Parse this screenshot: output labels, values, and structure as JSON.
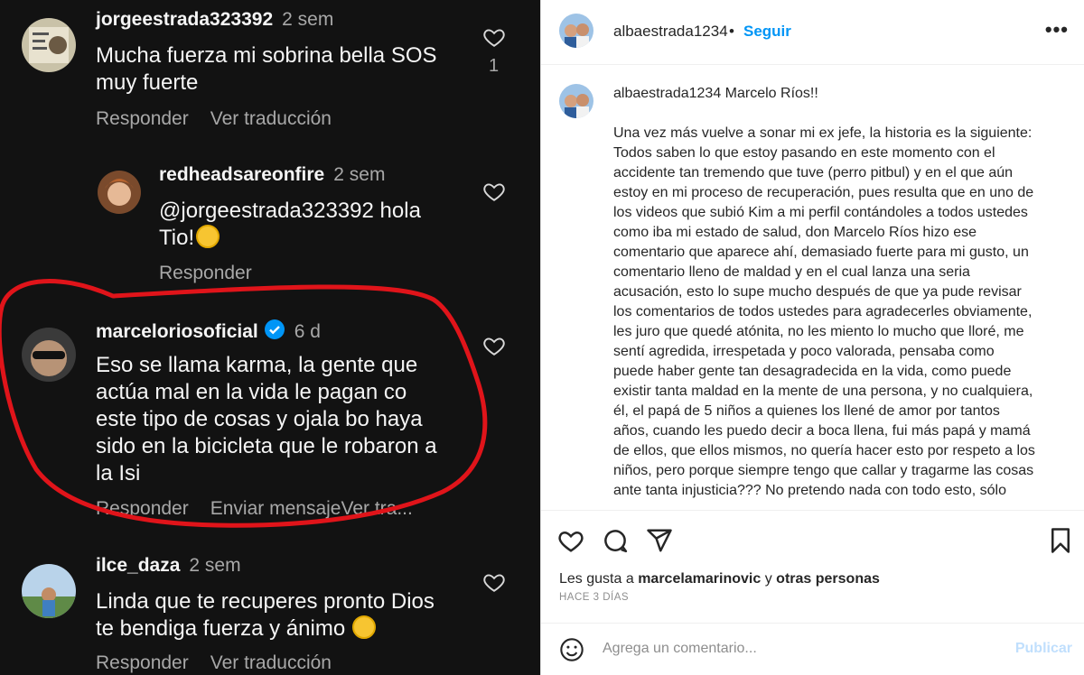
{
  "comments": [
    {
      "user": "jorgeestrada323392",
      "time": "2 sem",
      "text_lines": [
        "Mucha fuerza mi sobrina bella SOS",
        "muy fuerte"
      ],
      "actions": [
        "Responder",
        "Ver traducción"
      ],
      "likes": "1"
    },
    {
      "user": "redheadsareonfire",
      "time": "2 sem",
      "text_lines": [
        "@jorgeestrada323392 hola",
        "Tio!"
      ],
      "actions": [
        "Responder"
      ]
    },
    {
      "user": "marceloriosoficial",
      "time": "6 d",
      "verified": true,
      "text_lines": [
        "Eso se llama karma, la gente que",
        "actúa mal en la vida le pagan co",
        "este tipo de cosas y ojala bo haya",
        "sido en la bicicleta que le robaron a",
        "la Isi"
      ],
      "actions": [
        "Responder",
        "Enviar mensajeVer tra..."
      ]
    },
    {
      "user": "ilce_daza",
      "time": "2 sem",
      "text_lines": [
        "Linda que te recuperes pronto Dios",
        "te bendiga fuerza y ánimo"
      ],
      "actions": [
        "Responder",
        "Ver traducción"
      ]
    }
  ],
  "post": {
    "author": "albaestrada1234",
    "follow_label": "Seguir",
    "dot": "•",
    "more": "•••",
    "caption_first": "Marcelo Ríos!!",
    "caption_lines": [
      "Una vez más vuelve a sonar mi ex jefe, la historia es la siguiente:",
      "Todos saben lo que estoy pasando en este momento con el",
      "accidente tan tremendo que tuve (perro pitbul) y en el que aún",
      "estoy en mi proceso de recuperación, pues resulta que en uno de",
      "los videos que subió Kim a mi perfil contándoles a todos ustedes",
      "como iba mi estado de salud, don Marcelo Ríos hizo ese",
      "comentario que aparece ahí, demasiado fuerte para mi gusto, un",
      "comentario lleno de maldad y en el cual lanza una seria",
      "acusación, esto lo supe mucho después de que ya pude revisar",
      "los comentarios de todos ustedes para agradecerles obviamente,",
      "les juro que quedé atónita, no les miento lo mucho que lloré, me",
      "sentí agredida, irrespetada y poco valorada, pensaba como",
      "puede haber gente tan desagradecida en la vida, como puede",
      "existir tanta maldad en la mente de una persona, y no cualquiera,",
      "él, el papá de 5 niños a quienes los llené de amor por tantos",
      "años, cuando les puedo decir a boca llena, fui más papá y mamá",
      "de ellos, que ellos mismos, no quería hacer esto por respeto a los",
      "niños, pero porque siempre tengo que callar y tragarme las cosas",
      "ante tanta injusticia??? No pretendo nada con todo esto, sólo"
    ],
    "likes_prefix": "Les gusta a",
    "likes_user": "marcelamarinovic",
    "likes_and": "y",
    "likes_others": "otras personas",
    "date": "HACE 3 DÍAS",
    "comment_placeholder": "Agrega un comentario...",
    "publish_label": "Publicar"
  },
  "icons": [
    "heart-icon",
    "comment-icon",
    "share-icon",
    "bookmark-icon",
    "smile-icon",
    "verified-icon",
    "more-icon"
  ],
  "colors": {
    "link_blue": "#0095f6",
    "dark_bg": "#121212",
    "red_annotation": "#e0141a"
  }
}
